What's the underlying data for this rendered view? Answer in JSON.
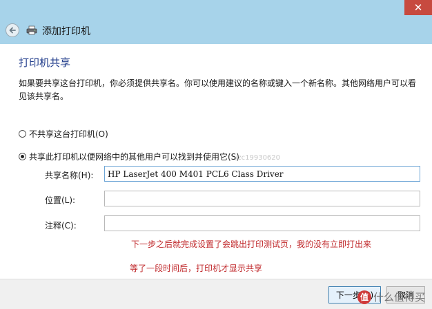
{
  "window": {
    "title": "添加打印机",
    "close_label": "✕"
  },
  "page": {
    "heading": "打印机共享",
    "description": "如果要共享这台打印机，你必须提供共享名。你可以使用建议的名称或键入一个新名称。其他网络用户可以看见该共享名。"
  },
  "options": [
    {
      "label": "不共享这台打印机(O)",
      "selected": false
    },
    {
      "label": "共享此打印机以便网络中的其他用户可以找到并使用它(S)",
      "selected": true
    }
  ],
  "fields": {
    "share_name": {
      "label": "共享名称(H):",
      "value": "HP LaserJet 400 M401 PCL6 Class Driver"
    },
    "location": {
      "label": "位置(L):",
      "value": ""
    },
    "comment": {
      "label": "注释(C):",
      "value": ""
    }
  },
  "annotations": {
    "note1": "下一步之后就完成设置了会跳出打印测试页，我的没有立即打出来",
    "note2": "等了一段时间后，打印机才显示共享",
    "watermark": "/zc19930620"
  },
  "buttons": {
    "next": "下一步(N)",
    "cancel": "取消"
  },
  "site_mark": {
    "badge": "值",
    "text": "什么值得买"
  },
  "colors": {
    "titlebar": "#a7d3ea",
    "close": "#c74a3f",
    "heading": "#1e3a8a",
    "note": "#c0282b"
  }
}
